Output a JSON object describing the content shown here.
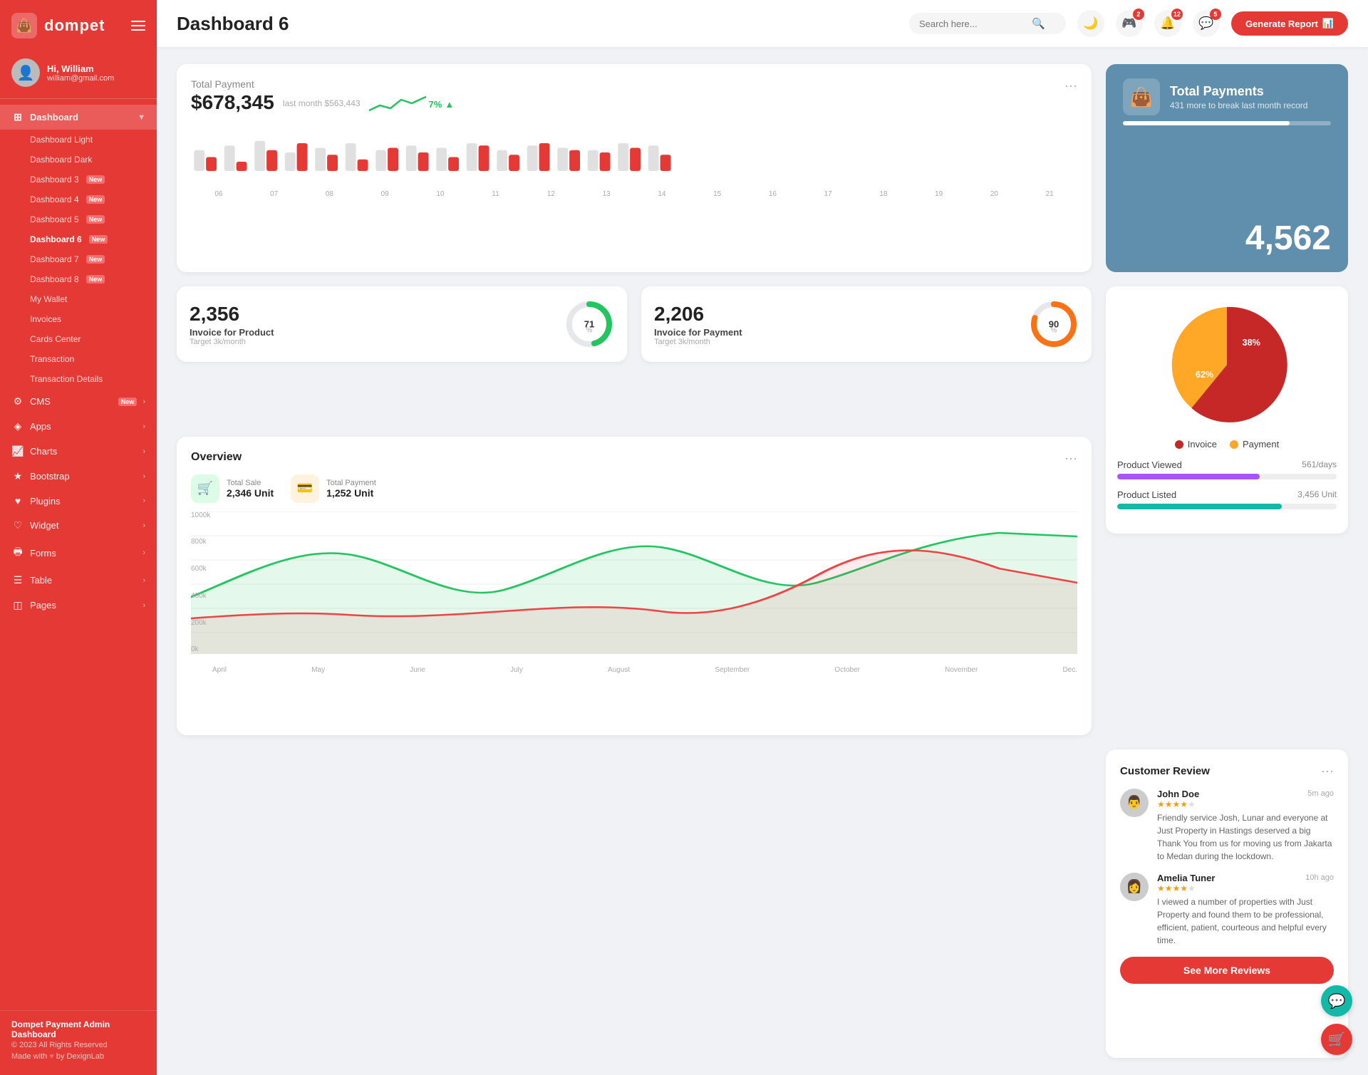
{
  "sidebar": {
    "logo_text": "dompet",
    "user": {
      "greeting": "Hi, William",
      "email": "william@gmail.com"
    },
    "nav": {
      "dashboard_label": "Dashboard",
      "sub_items": [
        {
          "label": "Dashboard Light",
          "active": false,
          "badge": ""
        },
        {
          "label": "Dashboard Dark",
          "active": false,
          "badge": ""
        },
        {
          "label": "Dashboard 3",
          "active": false,
          "badge": "New"
        },
        {
          "label": "Dashboard 4",
          "active": false,
          "badge": "New"
        },
        {
          "label": "Dashboard 5",
          "active": false,
          "badge": "New"
        },
        {
          "label": "Dashboard 6",
          "active": true,
          "badge": "New"
        },
        {
          "label": "Dashboard 7",
          "active": false,
          "badge": "New"
        },
        {
          "label": "Dashboard 8",
          "active": false,
          "badge": "New"
        },
        {
          "label": "My Wallet",
          "active": false,
          "badge": ""
        },
        {
          "label": "Invoices",
          "active": false,
          "badge": ""
        },
        {
          "label": "Cards Center",
          "active": false,
          "badge": ""
        },
        {
          "label": "Transaction",
          "active": false,
          "badge": ""
        },
        {
          "label": "Transaction Details",
          "active": false,
          "badge": ""
        }
      ],
      "main_items": [
        {
          "label": "CMS",
          "badge": "New",
          "has_arrow": true
        },
        {
          "label": "Apps",
          "badge": "",
          "has_arrow": true
        },
        {
          "label": "Charts",
          "badge": "",
          "has_arrow": true
        },
        {
          "label": "Bootstrap",
          "badge": "",
          "has_arrow": true
        },
        {
          "label": "Plugins",
          "badge": "",
          "has_arrow": true
        },
        {
          "label": "Widget",
          "badge": "",
          "has_arrow": true
        },
        {
          "label": "Forms",
          "badge": "",
          "has_arrow": true
        },
        {
          "label": "Table",
          "badge": "",
          "has_arrow": true
        },
        {
          "label": "Pages",
          "badge": "",
          "has_arrow": true
        }
      ]
    },
    "footer": {
      "title": "Dompet Payment Admin Dashboard",
      "copy": "© 2023 All Rights Reserved",
      "made_with": "Made with",
      "by": "by DexignLab"
    }
  },
  "topbar": {
    "title": "Dashboard 6",
    "search_placeholder": "Search here...",
    "notif_badges": {
      "gamepad": "2",
      "bell": "12",
      "message": "5"
    },
    "generate_btn": "Generate Report"
  },
  "total_payment": {
    "title": "Total Payment",
    "amount": "$678,345",
    "last_month_label": "last month $563,443",
    "trend_percent": "7%",
    "menu": "···",
    "bars": [
      {
        "gray": 45,
        "red": 30
      },
      {
        "gray": 55,
        "red": 20
      },
      {
        "gray": 65,
        "red": 45
      },
      {
        "gray": 40,
        "red": 60
      },
      {
        "gray": 50,
        "red": 35
      },
      {
        "gray": 60,
        "red": 25
      },
      {
        "gray": 45,
        "red": 50
      },
      {
        "gray": 55,
        "red": 40
      },
      {
        "gray": 50,
        "red": 30
      },
      {
        "gray": 60,
        "red": 55
      },
      {
        "gray": 45,
        "red": 35
      },
      {
        "gray": 55,
        "red": 60
      },
      {
        "gray": 50,
        "red": 45
      },
      {
        "gray": 45,
        "red": 40
      },
      {
        "gray": 60,
        "red": 50
      },
      {
        "gray": 55,
        "red": 35
      }
    ],
    "x_labels": [
      "06",
      "07",
      "08",
      "09",
      "10",
      "11",
      "12",
      "13",
      "14",
      "15",
      "16",
      "17",
      "18",
      "19",
      "20",
      "21"
    ]
  },
  "total_payments_blue": {
    "title": "Total Payments",
    "subtitle": "431 more to break last month record",
    "amount": "4,562",
    "bar_percent": 80
  },
  "invoice_product": {
    "number": "2,356",
    "label": "Invoice for Product",
    "target": "Target 3k/month",
    "percent": 71,
    "color": "#22c55e"
  },
  "invoice_payment": {
    "number": "2,206",
    "label": "Invoice for Payment",
    "target": "Target 3k/month",
    "percent": 90,
    "color": "#f97316"
  },
  "overview": {
    "title": "Overview",
    "menu": "···",
    "total_sale_label": "Total Sale",
    "total_sale_value": "2,346 Unit",
    "total_payment_label": "Total Payment",
    "total_payment_value": "1,252 Unit",
    "x_labels": [
      "April",
      "May",
      "June",
      "July",
      "August",
      "September",
      "October",
      "November",
      "Dec."
    ],
    "y_labels": [
      "0k",
      "200k",
      "400k",
      "600k",
      "800k",
      "1000k"
    ]
  },
  "pie_chart": {
    "invoice_label": "Invoice",
    "payment_label": "Payment",
    "invoice_percent": 62,
    "payment_percent": 38
  },
  "product_stats": {
    "viewed_label": "Product Viewed",
    "viewed_val": "561/days",
    "viewed_color": "#a855f7",
    "viewed_percent": 65,
    "listed_label": "Product Listed",
    "listed_val": "3,456 Unit",
    "listed_color": "#14b8a6",
    "listed_percent": 75
  },
  "customer_review": {
    "title": "Customer Review",
    "menu": "···",
    "reviews": [
      {
        "name": "John Doe",
        "stars": 4,
        "time": "5m ago",
        "text": "Friendly service Josh, Lunar and everyone at Just Property in Hastings deserved a big Thank You from us for moving us from Jakarta to Medan during the lockdown."
      },
      {
        "name": "Amelia Tuner",
        "stars": 4,
        "time": "10h ago",
        "text": "I viewed a number of properties with Just Property and found them to be professional, efficient, patient, courteous and helpful every time."
      }
    ],
    "see_more_btn": "See More Reviews"
  },
  "floating_btns": {
    "support": "💬",
    "cart": "🛒"
  }
}
